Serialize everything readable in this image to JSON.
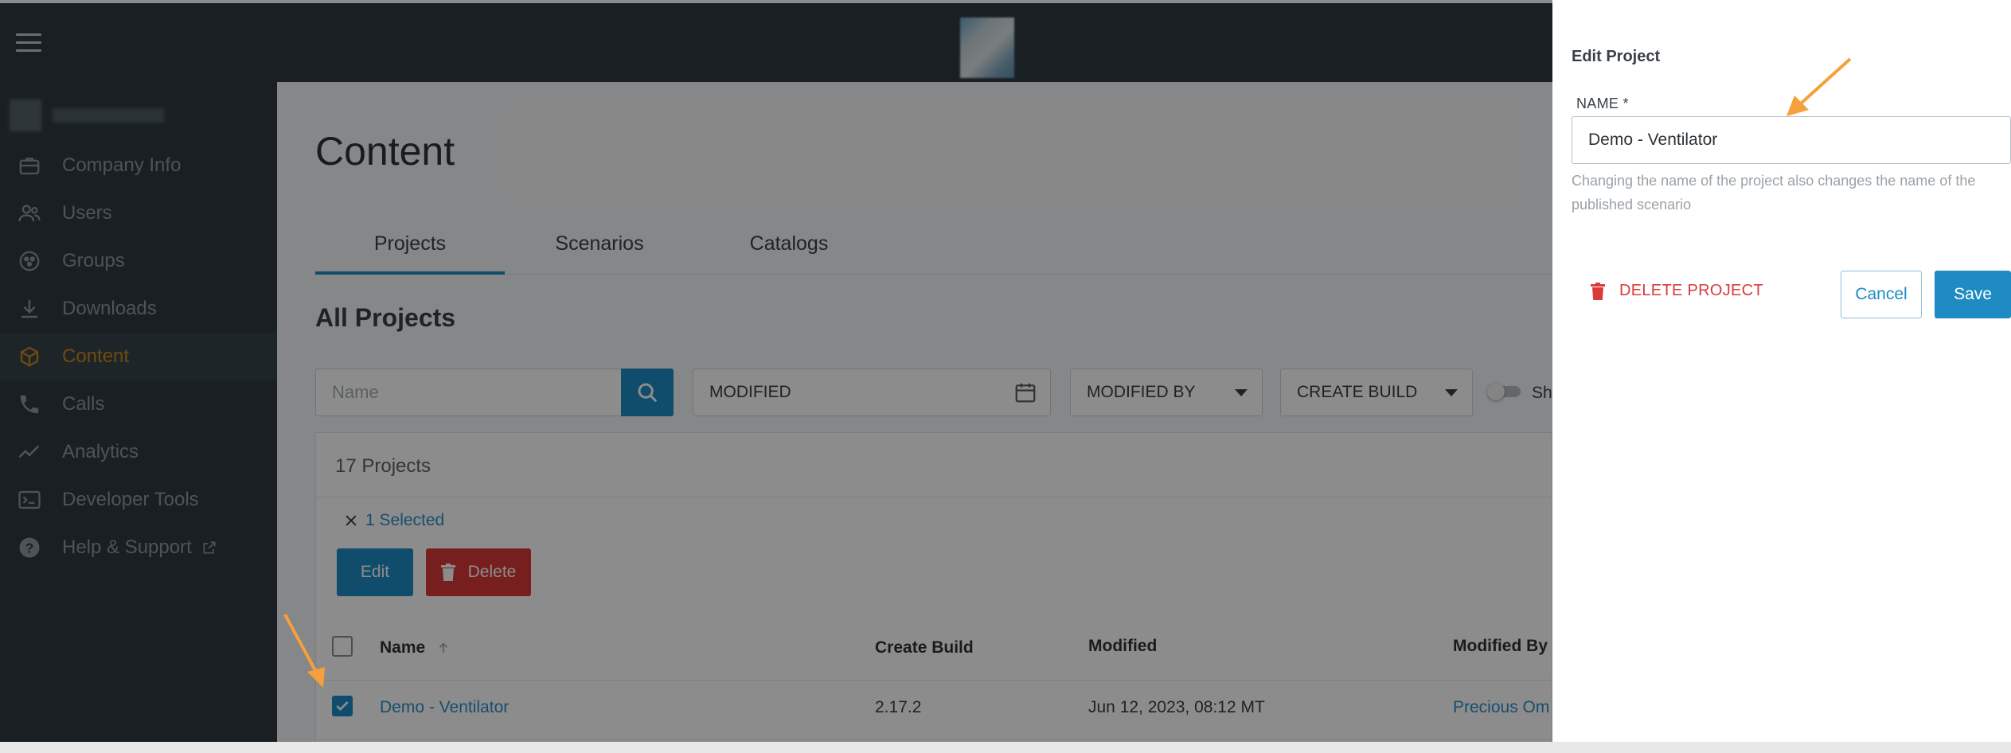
{
  "sidebar": {
    "items": [
      {
        "label": "Company Info",
        "icon": "briefcase-icon"
      },
      {
        "label": "Users",
        "icon": "users-icon"
      },
      {
        "label": "Groups",
        "icon": "groups-icon"
      },
      {
        "label": "Downloads",
        "icon": "download-icon"
      },
      {
        "label": "Content",
        "icon": "cube-icon",
        "active": true
      },
      {
        "label": "Calls",
        "icon": "phone-icon"
      },
      {
        "label": "Analytics",
        "icon": "chart-line-icon"
      },
      {
        "label": "Developer Tools",
        "icon": "terminal-icon"
      },
      {
        "label": "Help & Support",
        "icon": "help-icon",
        "external": true
      }
    ]
  },
  "main": {
    "title": "Content",
    "tabs": [
      {
        "label": "Projects",
        "active": true
      },
      {
        "label": "Scenarios"
      },
      {
        "label": "Catalogs"
      }
    ],
    "section_title": "All Projects",
    "filters": {
      "search_placeholder": "Name",
      "modified": "MODIFIED",
      "modified_by": "MODIFIED BY",
      "create_build": "CREATE BUILD",
      "toggle_label": "Sh"
    },
    "count": "17 Projects",
    "selected": "1 Selected",
    "actions": {
      "edit": "Edit",
      "delete": "Delete"
    },
    "table": {
      "headers": {
        "name": "Name",
        "create_build": "Create Build",
        "modified": "Modified",
        "modified_by": "Modified By"
      },
      "rows": [
        {
          "name": "Demo - Ventilator",
          "create_build": "2.17.2",
          "modified": "Jun 12, 2023, 08:12 MT",
          "modified_by": "Precious Om",
          "checked": true
        }
      ]
    }
  },
  "panel": {
    "title": "Edit Project",
    "name_label": "NAME *",
    "name_value": "Demo - Ventilator",
    "hint": "Changing the name of the project also changes the name of the published scenario",
    "delete_label": "DELETE PROJECT",
    "cancel": "Cancel",
    "save": "Save"
  },
  "colors": {
    "accent": "#1e8bc3",
    "danger": "#d93a3a",
    "active_nav": "#c9891b",
    "sidebar_bg": "#2f3a40",
    "annotation_arrow": "#f5a03a"
  }
}
